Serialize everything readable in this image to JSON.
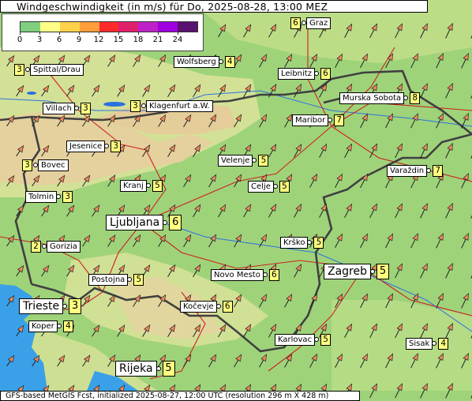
{
  "title": "Windgeschwindigkeit (in m/s) für Do, 2025-08-28, 13:00 MEZ",
  "footer": "GFS-based MetGIS Fcst, initialized 2025-08-27, 12:00 UTC (resolution 296 m X 428 m)",
  "legend": {
    "ticks": [
      "0",
      "3",
      "6",
      "9",
      "12",
      "15",
      "18",
      "21",
      "24"
    ],
    "colors": [
      "#7fcf7f",
      "#ffff88",
      "#ffd24a",
      "#ff9e3a",
      "#ff2a2a",
      "#e0206a",
      "#c020c8",
      "#a000e0",
      "#5a1070"
    ]
  },
  "colors": {
    "lowland": "#9fd37a",
    "hills": "#d8e29a",
    "mountains": "#e8c8a0",
    "sea": "#3aa0e8",
    "border": "#404040",
    "roads": "#cc2222",
    "arrow_fill": "#f08a5a"
  },
  "cities": [
    {
      "id": "graz",
      "name": "Graz",
      "value": "6"
    },
    {
      "id": "spittal",
      "name": "Spittal/Drau",
      "value": "3"
    },
    {
      "id": "wolfsberg",
      "name": "Wolfsberg",
      "value": "4"
    },
    {
      "id": "leibnitz",
      "name": "Leibnitz",
      "value": "6"
    },
    {
      "id": "villach",
      "name": "Villach",
      "value": "3"
    },
    {
      "id": "klagenfurt",
      "name": "Klagenfurt a.W.",
      "value": "3"
    },
    {
      "id": "murska",
      "name": "Murska Sobota",
      "value": "8"
    },
    {
      "id": "maribor",
      "name": "Maribor",
      "value": "7"
    },
    {
      "id": "jesenice",
      "name": "Jesenice",
      "value": "3"
    },
    {
      "id": "velenje",
      "name": "Velenje",
      "value": "5"
    },
    {
      "id": "bovec",
      "name": "Bovec",
      "value": "3"
    },
    {
      "id": "varazdin",
      "name": "Varaždin",
      "value": "7"
    },
    {
      "id": "kranj",
      "name": "Kranj",
      "value": "5"
    },
    {
      "id": "celje",
      "name": "Celje",
      "value": "5"
    },
    {
      "id": "tolmin",
      "name": "Tolmin",
      "value": "3"
    },
    {
      "id": "ljubljana",
      "name": "Ljubljana",
      "value": "6"
    },
    {
      "id": "gorizia",
      "name": "Gorizia",
      "value": "2"
    },
    {
      "id": "krsko",
      "name": "Krško",
      "value": "5"
    },
    {
      "id": "postojna",
      "name": "Postojna",
      "value": "5"
    },
    {
      "id": "novomesto",
      "name": "Novo Mesto",
      "value": "6"
    },
    {
      "id": "zagreb",
      "name": "Zagreb",
      "value": "5"
    },
    {
      "id": "trieste",
      "name": "Trieste",
      "value": "3"
    },
    {
      "id": "kocevje",
      "name": "Kočevje",
      "value": "6"
    },
    {
      "id": "koper",
      "name": "Koper",
      "value": "4"
    },
    {
      "id": "karlovac",
      "name": "Karlovac",
      "value": "5"
    },
    {
      "id": "sisak",
      "name": "Sisak",
      "value": "4"
    },
    {
      "id": "rijeka",
      "name": "Rijeka",
      "value": "5"
    }
  ]
}
